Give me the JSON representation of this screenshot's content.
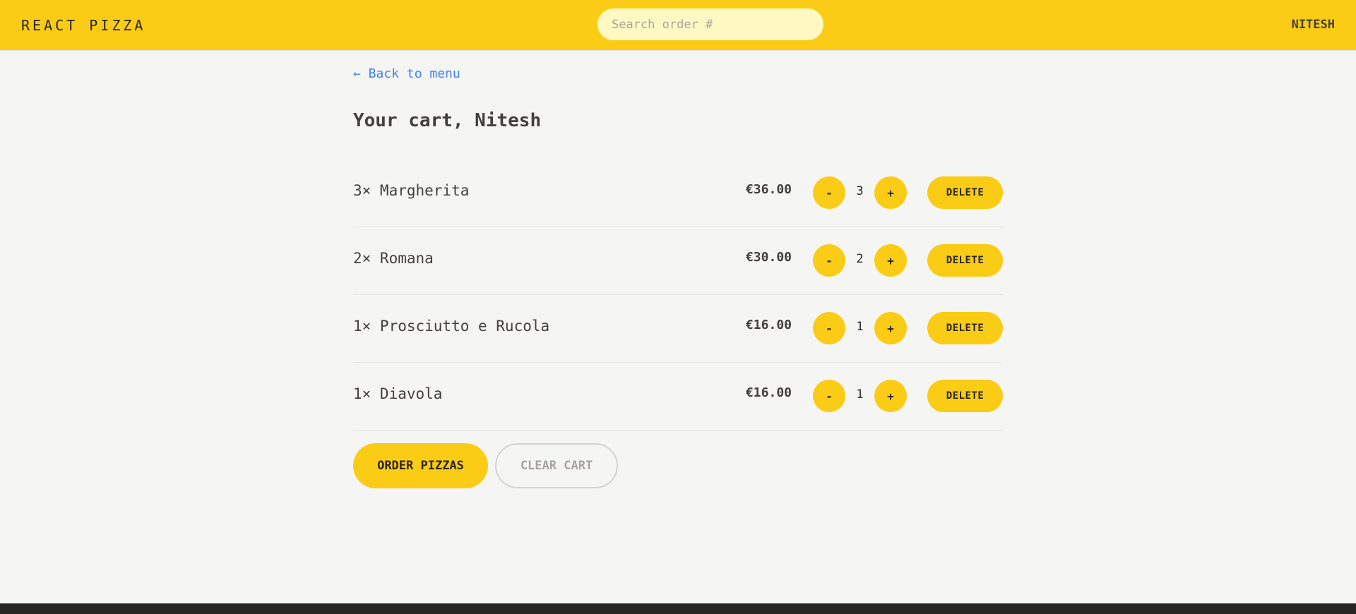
{
  "header": {
    "logo": "REACT PIZZA",
    "search_placeholder": "Search order #",
    "username": "NITESH"
  },
  "main": {
    "back_link": "← Back to menu",
    "title": "Your cart, Nitesh"
  },
  "cart": {
    "items": [
      {
        "label": "3× Margherita",
        "price": "€36.00",
        "quantity": "3"
      },
      {
        "label": "2× Romana",
        "price": "€30.00",
        "quantity": "2"
      },
      {
        "label": "1× Prosciutto e Rucola",
        "price": "€16.00",
        "quantity": "1"
      },
      {
        "label": "1× Diavola",
        "price": "€16.00",
        "quantity": "1"
      }
    ],
    "decrease_label": "-",
    "increase_label": "+",
    "delete_label": "DELETE"
  },
  "actions": {
    "order_label": "ORDER PIZZAS",
    "clear_label": "CLEAR CART"
  },
  "colors": {
    "accent": "#facc15",
    "background": "#f5f5f4",
    "link": "#3b82f6",
    "footer": "#292524"
  }
}
